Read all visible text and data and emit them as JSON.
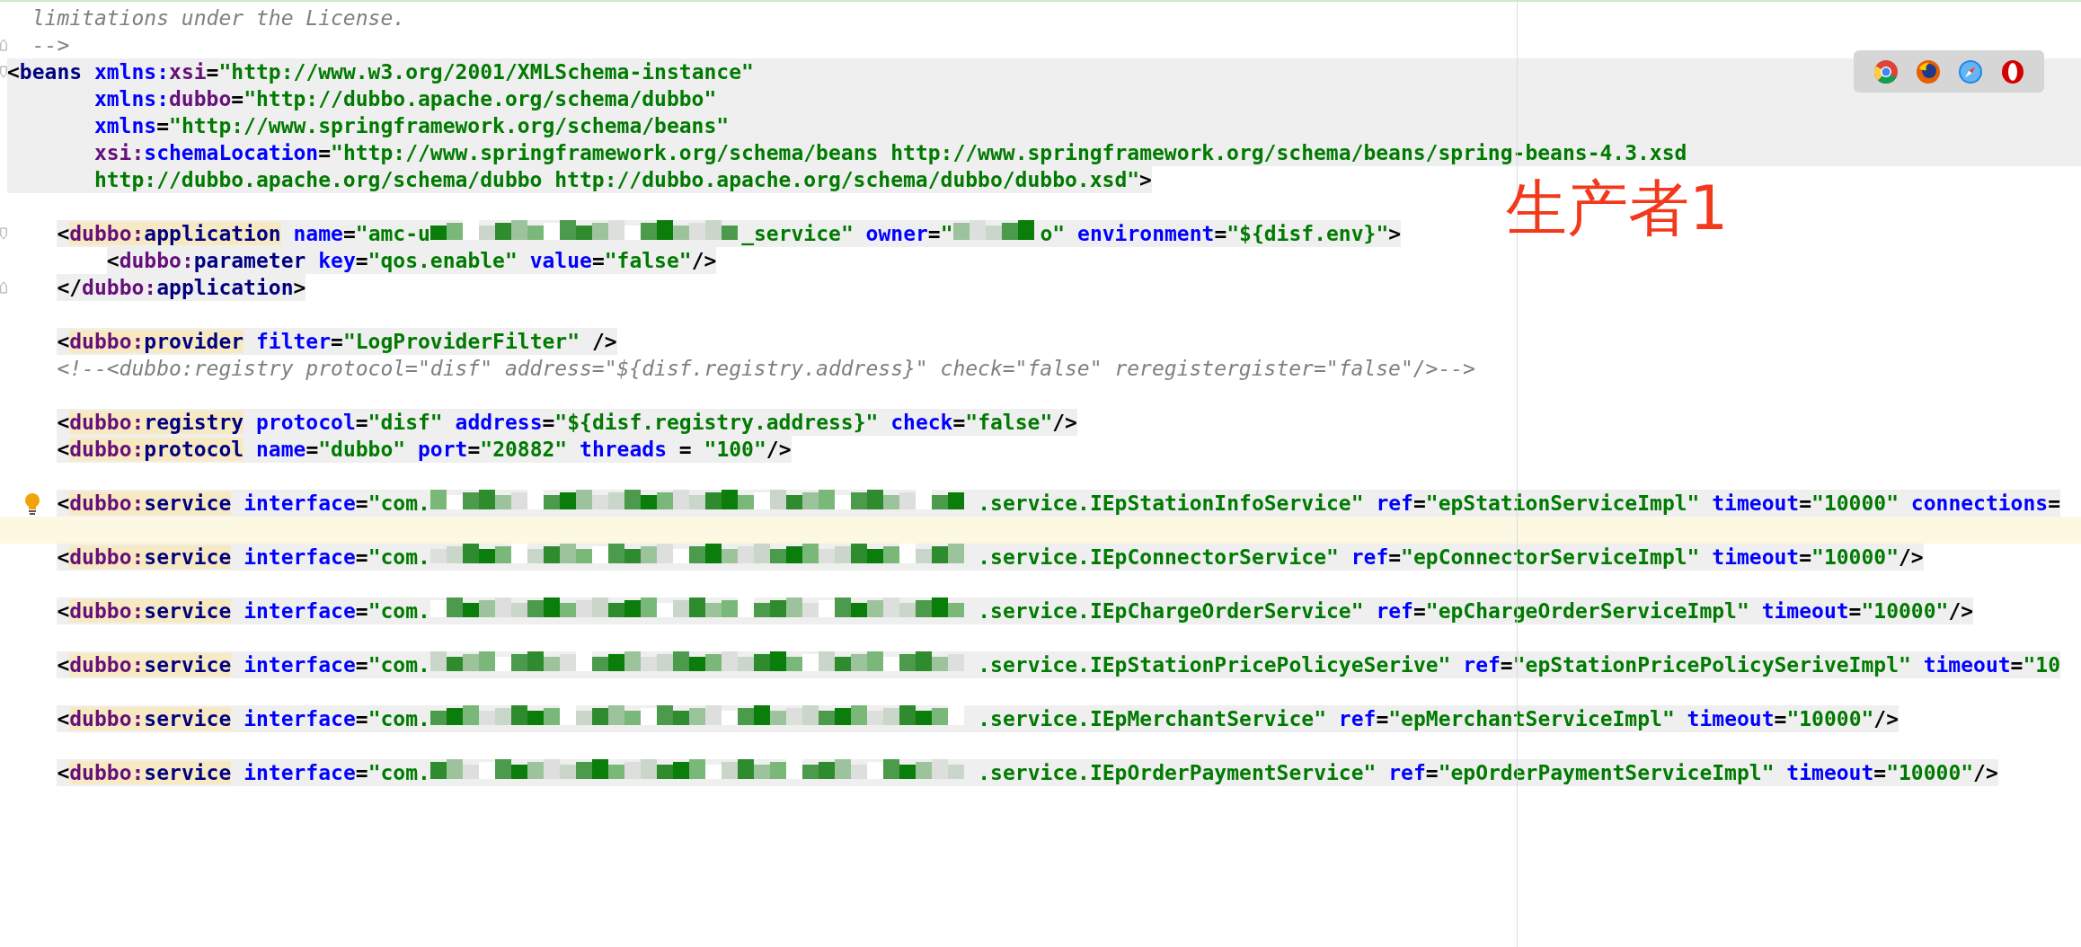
{
  "annotation": "生产者1",
  "browser_icons": [
    {
      "kind": "tricolor"
    },
    {
      "kind": "fox"
    },
    {
      "kind": "compass"
    },
    {
      "kind": "ring"
    }
  ],
  "lines": [
    {
      "kind": "plain",
      "tokens": [
        {
          "kind": "com",
          "text": "  limitations under the License."
        }
      ]
    },
    {
      "kind": "plain",
      "gutter": {
        "kind": "fold-end"
      },
      "tokens": [
        {
          "kind": "com",
          "text": "  -->"
        }
      ]
    },
    {
      "kind": "block-wide",
      "marked": false,
      "gutter": {
        "kind": "fold"
      },
      "tokens": [
        {
          "kind": "p",
          "text": "<"
        },
        {
          "kind": "tag",
          "text": "beans"
        },
        {
          "kind": "attr",
          "text": " xmlns:"
        },
        {
          "kind": "ns",
          "text": "xsi"
        },
        {
          "kind": "p",
          "text": "="
        },
        {
          "kind": "val",
          "text": "\"http://www.w3.org/2001/XMLSchema-instance\""
        }
      ]
    },
    {
      "kind": "block-wide",
      "marked": false,
      "tokens": [
        {
          "kind": "attr",
          "text": "       xmlns:"
        },
        {
          "kind": "ns",
          "text": "dubbo"
        },
        {
          "kind": "p",
          "text": "="
        },
        {
          "kind": "val",
          "text": "\"http://dubbo.apache.org/schema/dubbo\""
        }
      ]
    },
    {
      "kind": "block-wide",
      "tokens": [
        {
          "kind": "attr",
          "text": "       xmlns"
        },
        {
          "kind": "p",
          "text": "="
        },
        {
          "kind": "val",
          "text": "\"http://www.springframework.org/schema/beans\""
        }
      ]
    },
    {
      "kind": "block-wide",
      "marked": false,
      "tokens": [
        {
          "kind": "ns",
          "text": "       xsi:"
        },
        {
          "kind": "attr",
          "text": "schemaLocation"
        },
        {
          "kind": "p",
          "text": "="
        },
        {
          "kind": "val",
          "text": "\"http://www.springframework.org/schema/beans http://www.springframework.org/schema/beans/spring-beans-4.3.xsd"
        }
      ]
    },
    {
      "kind": "block",
      "tokens": [
        {
          "kind": "val",
          "text": "       http://dubbo.apache.org/schema/dubbo http://dubbo.apache.org/schema/dubbo/dubbo.xsd\""
        },
        {
          "kind": "p",
          "text": ">"
        }
      ]
    },
    {
      "kind": "blank"
    },
    {
      "kind": "shaded",
      "marked": true,
      "gutter": {
        "kind": "fold"
      },
      "tokens": [
        {
          "kind": "p",
          "text": "    <"
        },
        {
          "kind": "ns",
          "text": "dubbo:"
        },
        {
          "kind": "tag",
          "text": "application"
        },
        {
          "kind": "attr",
          "text": " name"
        },
        {
          "kind": "p",
          "text": "="
        },
        {
          "kind": "val",
          "text": "\"amc-u"
        },
        {
          "kind": "red"
        },
        {
          "kind": "val",
          "text": "_service\""
        },
        {
          "kind": "attr",
          "text": " owner"
        },
        {
          "kind": "p",
          "text": "="
        },
        {
          "kind": "val",
          "text": "\""
        },
        {
          "kind": "red"
        },
        {
          "kind": "val",
          "text": "o\""
        },
        {
          "kind": "attr",
          "text": " environment"
        },
        {
          "kind": "p",
          "text": "="
        },
        {
          "kind": "val",
          "text": "\"${disf.env}\""
        },
        {
          "kind": "p",
          "text": ">"
        }
      ]
    },
    {
      "kind": "shaded",
      "marked": false,
      "tokens": [
        {
          "kind": "p",
          "text": "        <"
        },
        {
          "kind": "ns",
          "text": "dubbo:"
        },
        {
          "kind": "tag",
          "text": "parameter"
        },
        {
          "kind": "attr",
          "text": " key"
        },
        {
          "kind": "p",
          "text": "="
        },
        {
          "kind": "val",
          "text": "\"qos.enable\""
        },
        {
          "kind": "attr",
          "text": " value"
        },
        {
          "kind": "p",
          "text": "="
        },
        {
          "kind": "val",
          "text": "\"false\""
        },
        {
          "kind": "p",
          "text": "/>"
        }
      ]
    },
    {
      "kind": "shaded",
      "marked": false,
      "gutter": {
        "kind": "fold-end"
      },
      "tokens": [
        {
          "kind": "p",
          "text": "    </"
        },
        {
          "kind": "ns",
          "text": "dubbo:"
        },
        {
          "kind": "tag",
          "text": "application"
        },
        {
          "kind": "p",
          "text": ">"
        }
      ]
    },
    {
      "kind": "blank"
    },
    {
      "kind": "shaded",
      "marked": true,
      "tokens": [
        {
          "kind": "p",
          "text": "    <"
        },
        {
          "kind": "ns",
          "text": "dubbo:"
        },
        {
          "kind": "tag",
          "text": "provider"
        },
        {
          "kind": "attr",
          "text": " filter"
        },
        {
          "kind": "p",
          "text": "="
        },
        {
          "kind": "val",
          "text": "\"LogProviderFilter\""
        },
        {
          "kind": "p",
          "text": " />"
        }
      ]
    },
    {
      "kind": "plain",
      "tokens": [
        {
          "kind": "com",
          "text": "    <!--<dubbo:registry protocol=\"disf\" address=\"${disf.registry.address}\" check=\"false\" reregistergister=\"false\"/>-->"
        }
      ]
    },
    {
      "kind": "blank"
    },
    {
      "kind": "shaded",
      "marked": true,
      "tokens": [
        {
          "kind": "p",
          "text": "    <"
        },
        {
          "kind": "ns",
          "text": "dubbo:"
        },
        {
          "kind": "tag",
          "text": "registry"
        },
        {
          "kind": "attr",
          "text": " protocol"
        },
        {
          "kind": "p",
          "text": "="
        },
        {
          "kind": "val",
          "text": "\"disf\""
        },
        {
          "kind": "attr",
          "text": " address"
        },
        {
          "kind": "p",
          "text": "="
        },
        {
          "kind": "val",
          "text": "\"${disf.registry.address}\""
        },
        {
          "kind": "attr",
          "text": " check"
        },
        {
          "kind": "p",
          "text": "="
        },
        {
          "kind": "val",
          "text": "\"false\""
        },
        {
          "kind": "p",
          "text": "/>"
        }
      ]
    },
    {
      "kind": "shaded",
      "marked": true,
      "tokens": [
        {
          "kind": "p",
          "text": "    <"
        },
        {
          "kind": "ns",
          "text": "dubbo:"
        },
        {
          "kind": "tag",
          "text": "protocol"
        },
        {
          "kind": "attr",
          "text": " name"
        },
        {
          "kind": "p",
          "text": "="
        },
        {
          "kind": "val",
          "text": "\"dubbo\""
        },
        {
          "kind": "attr",
          "text": " port"
        },
        {
          "kind": "p",
          "text": "="
        },
        {
          "kind": "val",
          "text": "\"20882\""
        },
        {
          "kind": "attr",
          "text": " threads"
        },
        {
          "kind": "p",
          "text": " = "
        },
        {
          "kind": "val",
          "text": "\"100\""
        },
        {
          "kind": "p",
          "text": "/>"
        }
      ]
    },
    {
      "kind": "blank"
    },
    {
      "kind": "shaded",
      "marked": true,
      "gutter": {
        "kind": "bulb"
      },
      "tokens": [
        {
          "kind": "p",
          "text": "    <"
        },
        {
          "kind": "ns",
          "text": "dubbo:"
        },
        {
          "kind": "tag",
          "text": "service"
        },
        {
          "kind": "attr",
          "text": " interface"
        },
        {
          "kind": "p",
          "text": "="
        },
        {
          "kind": "val",
          "text": "\"com."
        },
        {
          "kind": "red"
        },
        {
          "kind": "val",
          "text": ".service.IEpStationInfoService\""
        },
        {
          "kind": "attr",
          "text": " ref"
        },
        {
          "kind": "p",
          "text": "="
        },
        {
          "kind": "val",
          "text": "\"epStationServiceImpl\""
        },
        {
          "kind": "attr",
          "text": " timeout"
        },
        {
          "kind": "p",
          "text": "="
        },
        {
          "kind": "val",
          "text": "\"10000\""
        },
        {
          "kind": "attr",
          "text": " connections"
        },
        {
          "kind": "p",
          "text": "="
        }
      ]
    },
    {
      "kind": "caret"
    },
    {
      "kind": "shaded",
      "marked": true,
      "tokens": [
        {
          "kind": "p",
          "text": "    <"
        },
        {
          "kind": "ns",
          "text": "dubbo:"
        },
        {
          "kind": "tag",
          "text": "service"
        },
        {
          "kind": "attr",
          "text": " interface"
        },
        {
          "kind": "p",
          "text": "="
        },
        {
          "kind": "val",
          "text": "\"com."
        },
        {
          "kind": "red"
        },
        {
          "kind": "val",
          "text": ".service.IEpConnectorService\""
        },
        {
          "kind": "attr",
          "text": " ref"
        },
        {
          "kind": "p",
          "text": "="
        },
        {
          "kind": "val",
          "text": "\"epConnectorServiceImpl\""
        },
        {
          "kind": "attr",
          "text": " timeout"
        },
        {
          "kind": "p",
          "text": "="
        },
        {
          "kind": "val",
          "text": "\"10000\""
        },
        {
          "kind": "p",
          "text": "/>"
        }
      ]
    },
    {
      "kind": "blank"
    },
    {
      "kind": "shaded",
      "marked": true,
      "tokens": [
        {
          "kind": "p",
          "text": "    <"
        },
        {
          "kind": "ns",
          "text": "dubbo:"
        },
        {
          "kind": "tag",
          "text": "service"
        },
        {
          "kind": "attr",
          "text": " interface"
        },
        {
          "kind": "p",
          "text": "="
        },
        {
          "kind": "val",
          "text": "\"com."
        },
        {
          "kind": "red"
        },
        {
          "kind": "val",
          "text": ".service.IEpChargeOrderService\""
        },
        {
          "kind": "attr",
          "text": " ref"
        },
        {
          "kind": "p",
          "text": "="
        },
        {
          "kind": "val",
          "text": "\"epChargeOrderServiceImpl\""
        },
        {
          "kind": "attr",
          "text": " timeout"
        },
        {
          "kind": "p",
          "text": "="
        },
        {
          "kind": "val",
          "text": "\"10000\""
        },
        {
          "kind": "p",
          "text": "/>"
        }
      ]
    },
    {
      "kind": "blank"
    },
    {
      "kind": "shaded",
      "marked": true,
      "tokens": [
        {
          "kind": "p",
          "text": "    <"
        },
        {
          "kind": "ns",
          "text": "dubbo:"
        },
        {
          "kind": "tag",
          "text": "service"
        },
        {
          "kind": "attr",
          "text": " interface"
        },
        {
          "kind": "p",
          "text": "="
        },
        {
          "kind": "val",
          "text": "\"com."
        },
        {
          "kind": "red"
        },
        {
          "kind": "val",
          "text": ".service.IEpStationPricePolicyeSerive\""
        },
        {
          "kind": "attr",
          "text": " ref"
        },
        {
          "kind": "p",
          "text": "="
        },
        {
          "kind": "val",
          "text": "\"epStationPricePolicySeriveImpl\""
        },
        {
          "kind": "attr",
          "text": " timeout"
        },
        {
          "kind": "p",
          "text": "="
        },
        {
          "kind": "val",
          "text": "\"10"
        }
      ]
    },
    {
      "kind": "blank"
    },
    {
      "kind": "shaded",
      "marked": true,
      "tokens": [
        {
          "kind": "p",
          "text": "    <"
        },
        {
          "kind": "ns",
          "text": "dubbo:"
        },
        {
          "kind": "tag",
          "text": "service"
        },
        {
          "kind": "attr",
          "text": " interface"
        },
        {
          "kind": "p",
          "text": "="
        },
        {
          "kind": "val",
          "text": "\"com."
        },
        {
          "kind": "red"
        },
        {
          "kind": "val",
          "text": ".service.IEpMerchantService\""
        },
        {
          "kind": "attr",
          "text": " ref"
        },
        {
          "kind": "p",
          "text": "="
        },
        {
          "kind": "val",
          "text": "\"epMerchantServiceImpl\""
        },
        {
          "kind": "attr",
          "text": " timeout"
        },
        {
          "kind": "p",
          "text": "="
        },
        {
          "kind": "val",
          "text": "\"10000\""
        },
        {
          "kind": "p",
          "text": "/>"
        }
      ]
    },
    {
      "kind": "blank"
    },
    {
      "kind": "shaded",
      "marked": true,
      "tokens": [
        {
          "kind": "p",
          "text": "    <"
        },
        {
          "kind": "ns",
          "text": "dubbo:"
        },
        {
          "kind": "tag",
          "text": "service"
        },
        {
          "kind": "attr",
          "text": " interface"
        },
        {
          "kind": "p",
          "text": "="
        },
        {
          "kind": "val",
          "text": "\"com."
        },
        {
          "kind": "red"
        },
        {
          "kind": "val",
          "text": ".service.IEpOrderPaymentService\""
        },
        {
          "kind": "attr",
          "text": " ref"
        },
        {
          "kind": "p",
          "text": "="
        },
        {
          "kind": "val",
          "text": "\"epOrderPaymentServiceImpl\""
        },
        {
          "kind": "attr",
          "text": " timeout"
        },
        {
          "kind": "p",
          "text": "="
        },
        {
          "kind": "val",
          "text": "\"10000\""
        },
        {
          "kind": "p",
          "text": "/>"
        }
      ]
    }
  ]
}
